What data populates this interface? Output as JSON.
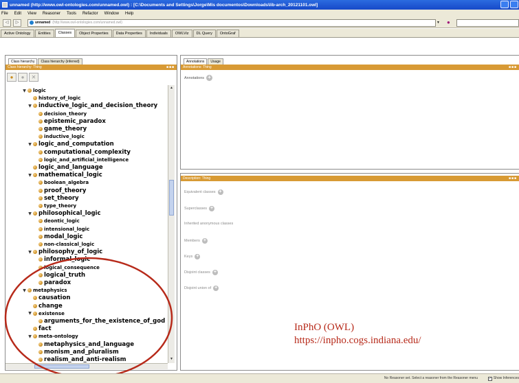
{
  "window": {
    "title": "unnamed (http://www.owl-ontologies.com/unnamed.owl) : [C:\\Documents and Settings\\Jorge\\Mis documentos\\Downloads\\lib-arch_20121101.owl]"
  },
  "menubar": [
    "File",
    "Edit",
    "View",
    "Reasoner",
    "Tools",
    "Refactor",
    "Window",
    "Help"
  ],
  "urlbar": {
    "ontology_name": "unnamed",
    "ontology_iri": "(http://www.owl-ontologies.com/unnamed.owl)"
  },
  "tabs": [
    {
      "label": "Active Ontology",
      "active": false
    },
    {
      "label": "Entities",
      "active": false
    },
    {
      "label": "Classes",
      "active": true
    },
    {
      "label": "Object Properties",
      "active": false
    },
    {
      "label": "Data Properties",
      "active": false
    },
    {
      "label": "Individuals",
      "active": false
    },
    {
      "label": "OWLViz",
      "active": false
    },
    {
      "label": "DL Query",
      "active": false
    },
    {
      "label": "OntoGraf",
      "active": false
    }
  ],
  "left_panel": {
    "subtabs": [
      "Class hierarchy",
      "Class hierarchy (inferred)"
    ],
    "header": "Class hierarchy: Thing"
  },
  "tree": [
    {
      "label": "logic",
      "depth": 0,
      "expanded": true,
      "size": "sm"
    },
    {
      "label": "history_of_logic",
      "depth": 1,
      "expanded": null,
      "size": "sm"
    },
    {
      "label": "inductive_logic_and_decision_theory",
      "depth": 1,
      "expanded": true,
      "size": "lg"
    },
    {
      "label": "decision_theory",
      "depth": 2,
      "expanded": null,
      "size": "sm"
    },
    {
      "label": "epistemic_paradox",
      "depth": 2,
      "expanded": null,
      "size": "lg"
    },
    {
      "label": "game_theory",
      "depth": 2,
      "expanded": null,
      "size": "lg"
    },
    {
      "label": "inductive_logic",
      "depth": 2,
      "expanded": null,
      "size": "sm"
    },
    {
      "label": "logic_and_computation",
      "depth": 1,
      "expanded": true,
      "size": "lg"
    },
    {
      "label": "computational_complexity",
      "depth": 2,
      "expanded": null,
      "size": "lg"
    },
    {
      "label": "logic_and_artificial_intelligence",
      "depth": 2,
      "expanded": null,
      "size": "sm"
    },
    {
      "label": "logic_and_language",
      "depth": 1,
      "expanded": null,
      "size": "lg"
    },
    {
      "label": "mathematical_logic",
      "depth": 1,
      "expanded": true,
      "size": "lg"
    },
    {
      "label": "boolean_algebra",
      "depth": 2,
      "expanded": null,
      "size": "sm"
    },
    {
      "label": "proof_theory",
      "depth": 2,
      "expanded": null,
      "size": "lg"
    },
    {
      "label": "set_theory",
      "depth": 2,
      "expanded": null,
      "size": "lg"
    },
    {
      "label": "type_theory",
      "depth": 2,
      "expanded": null,
      "size": "sm"
    },
    {
      "label": "philosophical_logic",
      "depth": 1,
      "expanded": true,
      "size": "lg"
    },
    {
      "label": "deontic_logic",
      "depth": 2,
      "expanded": null,
      "size": "sm"
    },
    {
      "label": "intensional_logic",
      "depth": 2,
      "expanded": null,
      "size": "sm"
    },
    {
      "label": "modal_logic",
      "depth": 2,
      "expanded": null,
      "size": "lg"
    },
    {
      "label": "non-classical_logic",
      "depth": 2,
      "expanded": null,
      "size": "sm"
    },
    {
      "label": "philosophy_of_logic",
      "depth": 1,
      "expanded": true,
      "size": "lg"
    },
    {
      "label": "informal_logic",
      "depth": 2,
      "expanded": null,
      "size": "lg"
    },
    {
      "label": "logical_consequence",
      "depth": 2,
      "expanded": null,
      "size": "sm"
    },
    {
      "label": "logical_truth",
      "depth": 2,
      "expanded": null,
      "size": "lg"
    },
    {
      "label": "paradox",
      "depth": 2,
      "expanded": null,
      "size": "lg"
    },
    {
      "label": "metaphysics",
      "depth": 0,
      "expanded": true,
      "size": "sm"
    },
    {
      "label": "causation",
      "depth": 1,
      "expanded": null,
      "size": "lg"
    },
    {
      "label": "change",
      "depth": 1,
      "expanded": null,
      "size": "lg"
    },
    {
      "label": "existense",
      "depth": 1,
      "expanded": true,
      "size": "sm"
    },
    {
      "label": "arguments_for_the_existence_of_god",
      "depth": 2,
      "expanded": null,
      "size": "lg"
    },
    {
      "label": "fact",
      "depth": 1,
      "expanded": null,
      "size": "lg"
    },
    {
      "label": "meta-ontology",
      "depth": 1,
      "expanded": true,
      "size": "sm"
    },
    {
      "label": "metaphysics_and_language",
      "depth": 2,
      "expanded": null,
      "size": "lg"
    },
    {
      "label": "monism_and_pluralism",
      "depth": 2,
      "expanded": null,
      "size": "lg"
    },
    {
      "label": "realism_and_anti-realism",
      "depth": 2,
      "expanded": null,
      "size": "lg"
    }
  ],
  "right_top": {
    "subtabs": [
      "Annotations",
      "Usage"
    ],
    "header": "Annotations: Thing",
    "annotations_label": "Annotations"
  },
  "right_bottom": {
    "header": "Description: Thing",
    "rows": [
      {
        "label": "Equivalent classes",
        "plus": true
      },
      {
        "label": "Superclasses",
        "plus": true
      },
      {
        "label": "Inherited anonymous classes",
        "plus": false
      },
      {
        "label": "Members",
        "plus": true
      },
      {
        "label": "Keys",
        "plus": true
      },
      {
        "label": "Disjoint classes",
        "plus": true
      },
      {
        "label": "Disjoint union of",
        "plus": true
      }
    ]
  },
  "caption": {
    "line1": "InPhO (OWL)",
    "line2": "https://inpho.cogs.indiana.edu/"
  },
  "statusbar": {
    "text": "No Reasoner set. Select a reasoner from the Reasoner menu",
    "show_inferences": "Show Inferences"
  },
  "colors": {
    "header_orange": "#d89a34",
    "annotation_red": "#b72a1a",
    "titlebar_blue": "#1749c8"
  }
}
